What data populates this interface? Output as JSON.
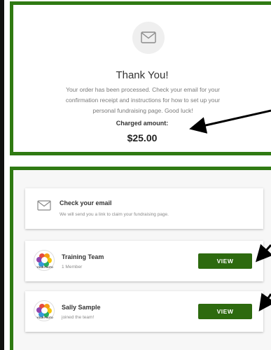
{
  "confirmation": {
    "title": "Thank You!",
    "message": "Your order has been processed. Check your email for your confirmation receipt and instructions for how to set up your personal fundraising page. Good luck!",
    "charged_label": "Charged amount:",
    "charged_value": "$25.00"
  },
  "email_card": {
    "title": "Check your email",
    "subtitle": "We will send you a link to claim your fundraising page."
  },
  "team_card": {
    "title": "Training Team",
    "subtitle": "1 Member",
    "button": "VIEW",
    "logo_text": "YOUR PHOTO"
  },
  "member_card": {
    "title": "Sally Sample",
    "subtitle": "joined the team!",
    "button": "VIEW",
    "logo_text": "YOUR PHOTO"
  },
  "colors": {
    "border_green": "#2f7a12",
    "button_green": "#2d6a0f"
  },
  "icons": [
    "envelope-icon",
    "team-logo",
    "arrow-annotation"
  ]
}
